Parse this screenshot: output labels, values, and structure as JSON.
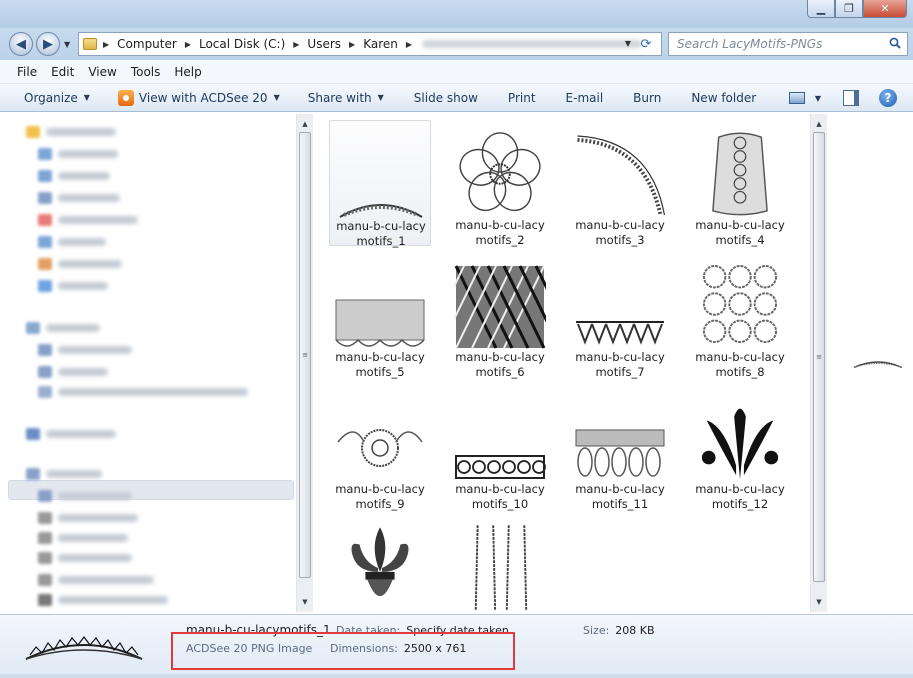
{
  "address": {
    "crumbs": [
      "Computer",
      "Local Disk (C:)",
      "Users",
      "Karen"
    ],
    "search_placeholder": "Search LacyMotifs-PNGs"
  },
  "menubar": {
    "items": [
      "File",
      "Edit",
      "View",
      "Tools",
      "Help"
    ]
  },
  "toolbar": {
    "organize": "Organize",
    "view_with": "View with ACDSee 20",
    "share_with": "Share with",
    "slide_show": "Slide show",
    "print": "Print",
    "email": "E-mail",
    "burn": "Burn",
    "new_folder": "New folder"
  },
  "files": [
    {
      "line1": "manu-b-cu-lacy",
      "line2": "motifs_1"
    },
    {
      "line1": "manu-b-cu-lacy",
      "line2": "motifs_2"
    },
    {
      "line1": "manu-b-cu-lacy",
      "line2": "motifs_3"
    },
    {
      "line1": "manu-b-cu-lacy",
      "line2": "motifs_4"
    },
    {
      "line1": "manu-b-cu-lacy",
      "line2": "motifs_5"
    },
    {
      "line1": "manu-b-cu-lacy",
      "line2": "motifs_6"
    },
    {
      "line1": "manu-b-cu-lacy",
      "line2": "motifs_7"
    },
    {
      "line1": "manu-b-cu-lacy",
      "line2": "motifs_8"
    },
    {
      "line1": "manu-b-cu-lacy",
      "line2": "motifs_9"
    },
    {
      "line1": "manu-b-cu-lacy",
      "line2": "motifs_10"
    },
    {
      "line1": "manu-b-cu-lacy",
      "line2": "motifs_11"
    },
    {
      "line1": "manu-b-cu-lacy",
      "line2": "motifs_12"
    },
    {
      "line1": "",
      "line2": ""
    },
    {
      "line1": "",
      "line2": ""
    }
  ],
  "details": {
    "name": "manu-b-cu-lacymotifs_1",
    "date_taken_label": "Date taken:",
    "date_taken_value": "Specify date taken",
    "size_label": "Size:",
    "size_value": "208 KB",
    "type": "ACDSee 20 PNG Image",
    "dimensions_label": "Dimensions:",
    "dimensions_value": "2500 x 761"
  },
  "colors": {
    "highlight_box": "#e03a3a",
    "toolbar_text": "#1e395b"
  }
}
